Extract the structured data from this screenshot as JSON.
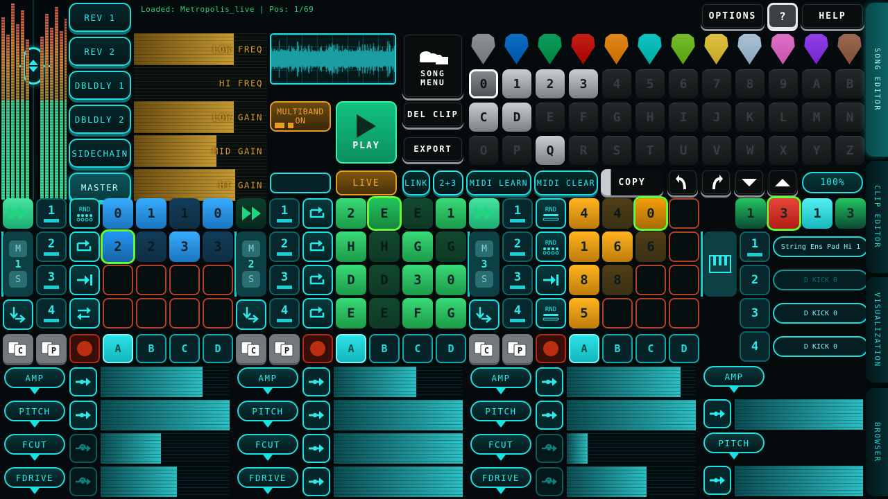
{
  "status": {
    "text": "Loaded: Metropolis_live | Pos: 1/69"
  },
  "header": {
    "options_label": "OPTIONS",
    "help_q_label": "?",
    "help_label": "HELP"
  },
  "fx_bank": {
    "items": [
      {
        "label": "REV 1",
        "active": false
      },
      {
        "label": "REV 2",
        "active": false
      },
      {
        "label": "DBLDLY 1",
        "active": false
      },
      {
        "label": "DBLDLY 2",
        "active": false
      },
      {
        "label": "SIDECHAIN",
        "active": false
      },
      {
        "label": "MASTER",
        "active": true
      }
    ]
  },
  "eq": {
    "rows": [
      {
        "label": "LOW FREQ",
        "value": 75
      },
      {
        "label": "HI FREQ",
        "value": 0
      },
      {
        "label": "LOW GAIN",
        "value": 75
      },
      {
        "label": "MID GAIN",
        "value": 62
      },
      {
        "label": "HI GAIN",
        "value": 76
      }
    ]
  },
  "transport": {
    "multiband_label": "MULTIBAND\nON",
    "multiband_line1": "MULTIBAND",
    "multiband_line2": "ON",
    "play_label": "PLAY",
    "live_label": "LIVE",
    "blank_field_value": ""
  },
  "song_controls": {
    "song_menu_line1": "SONG",
    "song_menu_line2": "MENU",
    "del_clip_label": "DEL CLIP",
    "export_label": "EXPORT"
  },
  "mid_controls": {
    "link_label": "LINK",
    "two_plus_three_label": "2+3",
    "midi_learn_label": "MIDI LEARN",
    "midi_clear_label": "MIDI CLEAR",
    "copy_label": "COPY",
    "zoom_label": "100%"
  },
  "pick_colors": [
    "#8d9294",
    "#0d6fc4",
    "#0c9e5c",
    "#c32018",
    "#e3881a",
    "#0ec5c0",
    "#76bd2e",
    "#e0c243",
    "#a9c2d6",
    "#e170c8",
    "#9040e8",
    "#9b6a52"
  ],
  "clip_grid": {
    "rows": [
      {
        "cells": [
          {
            "label": "0",
            "state": "selected"
          },
          {
            "label": "1",
            "state": "light"
          },
          {
            "label": "2",
            "state": "light"
          },
          {
            "label": "3",
            "state": "light"
          },
          {
            "label": "4",
            "state": "dim"
          },
          {
            "label": "5",
            "state": "dim"
          },
          {
            "label": "6",
            "state": "dim"
          },
          {
            "label": "7",
            "state": "dim"
          },
          {
            "label": "8",
            "state": "dim"
          },
          {
            "label": "9",
            "state": "dim"
          },
          {
            "label": "A",
            "state": "dim"
          },
          {
            "label": "B",
            "state": "dim"
          }
        ]
      },
      {
        "cells": [
          {
            "label": "C",
            "state": "light"
          },
          {
            "label": "D",
            "state": "light"
          },
          {
            "label": "E",
            "state": "dim"
          },
          {
            "label": "F",
            "state": "dim"
          },
          {
            "label": "G",
            "state": "dim"
          },
          {
            "label": "H",
            "state": "dim"
          },
          {
            "label": "I",
            "state": "dim"
          },
          {
            "label": "J",
            "state": "dim"
          },
          {
            "label": "K",
            "state": "dim"
          },
          {
            "label": "L",
            "state": "dim"
          },
          {
            "label": "M",
            "state": "dim"
          },
          {
            "label": "N",
            "state": "dim"
          }
        ]
      },
      {
        "cells": [
          {
            "label": "O",
            "state": "dim"
          },
          {
            "label": "P",
            "state": "dim"
          },
          {
            "label": "Q",
            "state": "light"
          },
          {
            "label": "R",
            "state": "dim"
          },
          {
            "label": "S",
            "state": "dim"
          },
          {
            "label": "T",
            "state": "dim"
          },
          {
            "label": "U",
            "state": "dim"
          },
          {
            "label": "V",
            "state": "dim"
          },
          {
            "label": "W",
            "state": "dim"
          },
          {
            "label": "X",
            "state": "dim"
          },
          {
            "label": "Y",
            "state": "dim"
          },
          {
            "label": "Z",
            "state": "dim"
          }
        ]
      }
    ]
  },
  "tracks": [
    {
      "number": "1",
      "accent": "#2196f3",
      "ffwd_active": true,
      "mute_label": "M",
      "solo_label": "S",
      "steps": [
        "1",
        "2",
        "3",
        "4"
      ],
      "mode_icons": [
        "rnd-dots-icon",
        "loop-icon",
        "to-end-icon",
        "swap-icon"
      ],
      "pads": [
        [
          {
            "l": "0",
            "s": "on"
          },
          {
            "l": "1",
            "s": "on"
          },
          {
            "l": "1",
            "s": "off"
          },
          {
            "l": "0",
            "s": "on"
          }
        ],
        [
          {
            "l": "2",
            "s": "cursor"
          },
          {
            "l": "2",
            "s": "off"
          },
          {
            "l": "3",
            "s": "on"
          },
          {
            "l": "3",
            "s": "off"
          }
        ],
        [
          {
            "l": "",
            "s": "empty"
          },
          {
            "l": "",
            "s": "empty"
          },
          {
            "l": "",
            "s": "empty"
          },
          {
            "l": "",
            "s": "empty"
          }
        ],
        [
          {
            "l": "",
            "s": "empty"
          },
          {
            "l": "",
            "s": "empty"
          },
          {
            "l": "",
            "s": "empty"
          },
          {
            "l": "",
            "s": "empty"
          }
        ]
      ],
      "abcd": [
        "A",
        "B",
        "C",
        "D"
      ],
      "abcd_active": 0,
      "params": [
        {
          "label": "AMP",
          "mode": "line",
          "mode_on": true,
          "value": 79
        },
        {
          "label": "PITCH",
          "mode": "line",
          "mode_on": true,
          "value": 100
        },
        {
          "label": "FCUT",
          "mode": "curve",
          "mode_on": false,
          "value": 47
        },
        {
          "label": "FDRIVE",
          "mode": "curve",
          "mode_on": false,
          "value": 59
        }
      ]
    },
    {
      "number": "2",
      "accent": "#22c55e",
      "ffwd_active": false,
      "mute_label": "M",
      "solo_label": "S",
      "steps": [
        "1",
        "2",
        "3",
        "4"
      ],
      "mode_icons": [
        "loop-icon",
        "loop-icon",
        "loop-icon",
        "loop-icon"
      ],
      "pads": [
        [
          {
            "l": "2",
            "s": "on"
          },
          {
            "l": "E",
            "s": "cursor"
          },
          {
            "l": "E",
            "s": "off"
          },
          {
            "l": "1",
            "s": "on"
          }
        ],
        [
          {
            "l": "H",
            "s": "on"
          },
          {
            "l": "H",
            "s": "off"
          },
          {
            "l": "G",
            "s": "on"
          },
          {
            "l": "G",
            "s": "off"
          }
        ],
        [
          {
            "l": "D",
            "s": "on"
          },
          {
            "l": "D",
            "s": "off"
          },
          {
            "l": "3",
            "s": "on"
          },
          {
            "l": "0",
            "s": "on"
          }
        ],
        [
          {
            "l": "E",
            "s": "on"
          },
          {
            "l": "E",
            "s": "off"
          },
          {
            "l": "F",
            "s": "on"
          },
          {
            "l": "G",
            "s": "on"
          }
        ]
      ],
      "abcd": [
        "A",
        "B",
        "C",
        "D"
      ],
      "abcd_active": 0,
      "params": [
        {
          "label": "AMP",
          "mode": "line",
          "mode_on": true,
          "value": 64
        },
        {
          "label": "PITCH",
          "mode": "line",
          "mode_on": true,
          "value": 100
        },
        {
          "label": "FCUT",
          "mode": "line",
          "mode_on": true,
          "value": 100
        },
        {
          "label": "FDRIVE",
          "mode": "line",
          "mode_on": true,
          "value": 100
        }
      ]
    },
    {
      "number": "3",
      "accent": "#f59e0b",
      "ffwd_active": true,
      "mute_label": "M",
      "solo_label": "S",
      "steps": [
        "1",
        "2",
        "3",
        "4"
      ],
      "mode_icons": [
        "rnd-bars-icon",
        "rnd-dots-icon",
        "to-end-icon",
        "rnd-bars-icon"
      ],
      "pads": [
        [
          {
            "l": "4",
            "s": "on"
          },
          {
            "l": "4",
            "s": "off"
          },
          {
            "l": "0",
            "s": "cursor"
          },
          {
            "l": "",
            "s": "empty"
          }
        ],
        [
          {
            "l": "1",
            "s": "on"
          },
          {
            "l": "6",
            "s": "on"
          },
          {
            "l": "6",
            "s": "off"
          },
          {
            "l": "",
            "s": "empty"
          }
        ],
        [
          {
            "l": "8",
            "s": "on"
          },
          {
            "l": "8",
            "s": "off"
          },
          {
            "l": "",
            "s": "empty"
          },
          {
            "l": "",
            "s": "empty"
          }
        ],
        [
          {
            "l": "5",
            "s": "on"
          },
          {
            "l": "",
            "s": "empty"
          },
          {
            "l": "",
            "s": "empty"
          },
          {
            "l": "",
            "s": "empty"
          }
        ]
      ],
      "abcd": [
        "A",
        "B",
        "C",
        "D"
      ],
      "abcd_active": 0,
      "params": [
        {
          "label": "AMP",
          "mode": "line",
          "mode_on": true,
          "value": 88
        },
        {
          "label": "PITCH",
          "mode": "line",
          "mode_on": true,
          "value": 100
        },
        {
          "label": "FCUT",
          "mode": "curve",
          "mode_on": false,
          "value": 16
        },
        {
          "label": "FDRIVE",
          "mode": "curve",
          "mode_on": false,
          "value": 62
        }
      ]
    }
  ],
  "browser": {
    "top_pads": [
      {
        "l": "1",
        "c": "#22c55e"
      },
      {
        "l": "3",
        "c": "#e03028",
        "cursor": true
      },
      {
        "l": "1",
        "c": "#2ae2e5"
      },
      {
        "l": "3",
        "c": "#22c55e"
      }
    ],
    "keys_icon": "piano-keys-icon",
    "slots": [
      {
        "num": "1",
        "name": "String Ens Pad Hi 1",
        "dim": false
      },
      {
        "num": "2",
        "name": "D KICK 0",
        "dim": true
      },
      {
        "num": "3",
        "name": "D KICK 0",
        "dim": false
      },
      {
        "num": "4",
        "name": "D KICK 0",
        "dim": false
      }
    ],
    "params": [
      {
        "label": "AMP",
        "value": 100
      },
      {
        "label": "PITCH",
        "value": 100
      }
    ]
  },
  "side_tabs": [
    {
      "label": "SONG EDITOR",
      "active": true
    },
    {
      "label": "CLIP EDITOR",
      "active": false
    },
    {
      "label": "VISUALIZATION",
      "active": false
    },
    {
      "label": "BROWSER",
      "active": false
    }
  ]
}
